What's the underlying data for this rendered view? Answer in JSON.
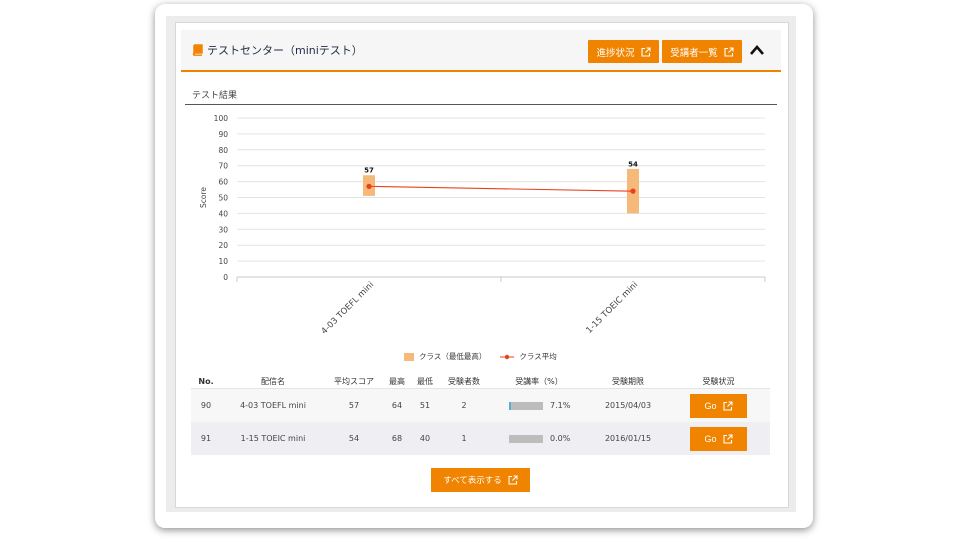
{
  "panel": {
    "title": "テストセンター（miniテスト）",
    "buttons": {
      "progress": "進捗状況",
      "students": "受講者一覧"
    },
    "section_label": "テスト結果"
  },
  "colors": {
    "accent": "#f08300",
    "range": "#f5b97a",
    "average": "#e8411e",
    "rate": "#5aaed6"
  },
  "chart_data": {
    "type": "bar",
    "categories": [
      "4-03 TOEFL mini",
      "1-15 TOEIC mini"
    ],
    "series": [
      {
        "name": "クラス（最低最高）",
        "kind": "range",
        "low": [
          51,
          40
        ],
        "high": [
          64,
          68
        ]
      },
      {
        "name": "クラス平均",
        "kind": "line",
        "values": [
          57,
          54
        ]
      }
    ],
    "data_labels": [
      "57",
      "54"
    ],
    "ylabel": "Score",
    "ylim": [
      0,
      100
    ],
    "yticks": [
      "100",
      "90",
      "80",
      "70",
      "60",
      "50",
      "40",
      "30",
      "20",
      "10",
      "0"
    ],
    "grid": true,
    "legend": "bottom"
  },
  "table": {
    "headers": [
      "No.",
      "配信名",
      "平均スコア",
      "最高",
      "最低",
      "受験者数",
      "受講率（%）",
      "受験期限",
      "受験状況"
    ],
    "rows": [
      {
        "no": "90",
        "name": "4-03 TOEFL mini",
        "avg": "57",
        "max": "64",
        "min": "51",
        "count": "2",
        "rate": 7.1,
        "rate_text": "7.1%",
        "deadline": "2015/04/03",
        "action": "Go"
      },
      {
        "no": "91",
        "name": "1-15 TOEIC mini",
        "avg": "54",
        "max": "68",
        "min": "40",
        "count": "1",
        "rate": 0.0,
        "rate_text": "0.0%",
        "deadline": "2016/01/15",
        "action": "Go"
      }
    ]
  },
  "show_all": "すべて表示する"
}
